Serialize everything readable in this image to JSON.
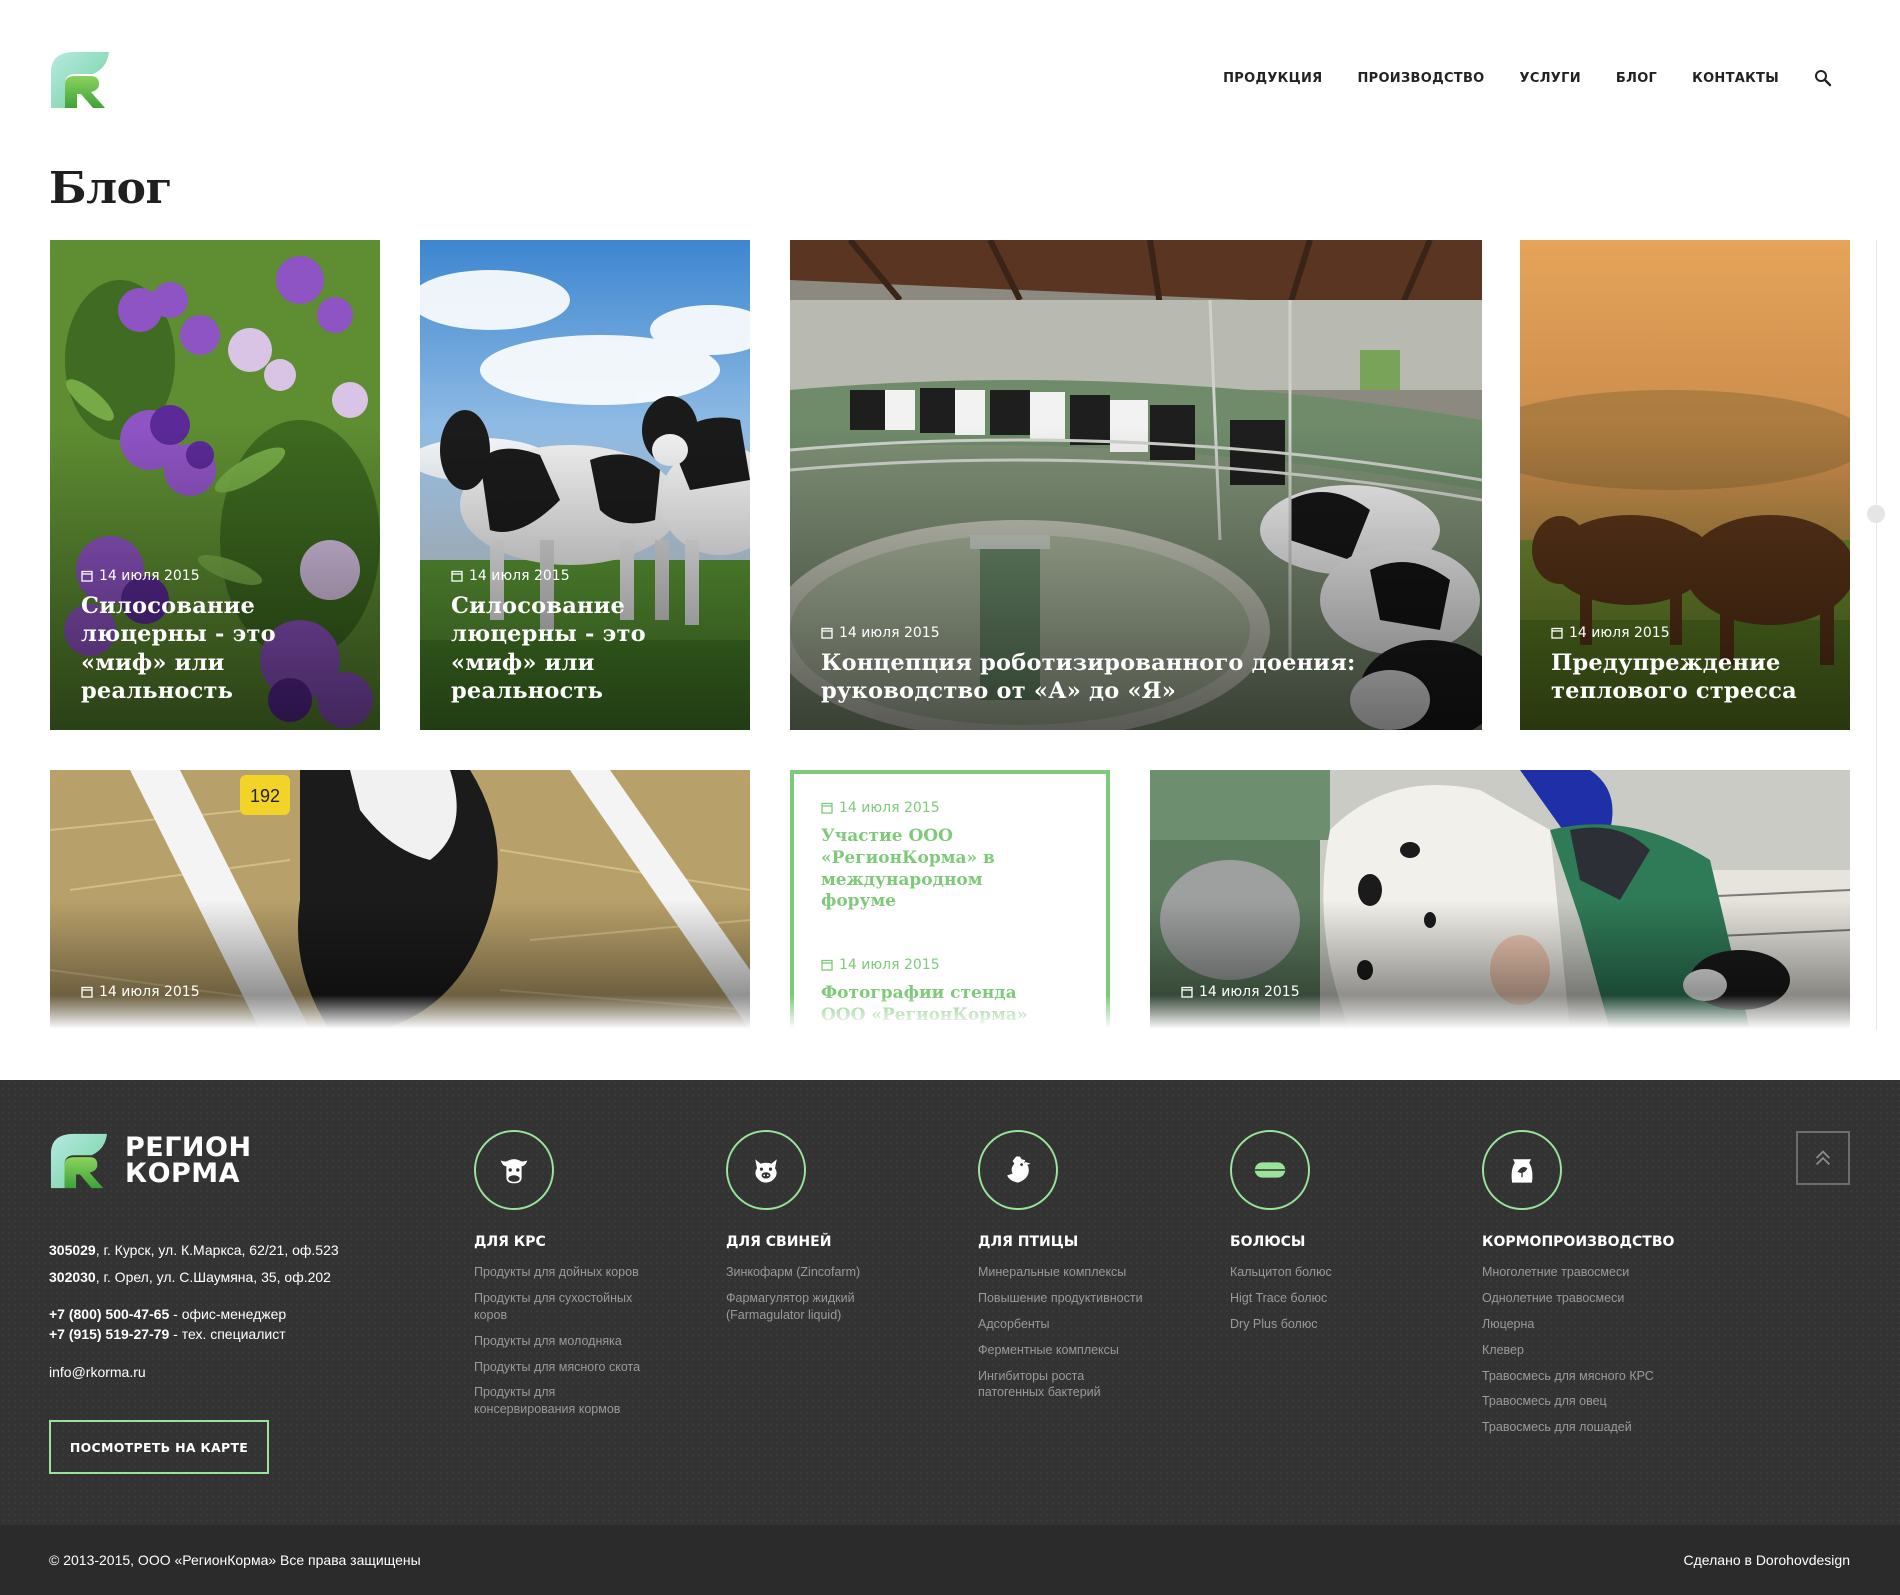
{
  "header": {
    "nav": [
      "ПРОДУКЦИЯ",
      "ПРОИЗВОДСТВО",
      "УСЛУГИ",
      "БЛОГ",
      "КОНТАКТЫ"
    ]
  },
  "page": {
    "title": "Блог"
  },
  "posts": [
    {
      "date": "14 июля 2015",
      "title": "Силосование люцерны - это «миф» или реальность",
      "image": "alfalfa-flowers"
    },
    {
      "date": "14 июля 2015",
      "title": "Силосование люцерны - это «миф» или реальность",
      "image": "cows-on-grass"
    },
    {
      "date": "14 июля 2015",
      "title": "Концепция роботизированного доения: руководство от «А» до «Я»",
      "image": "rotary-milking-parlor"
    },
    {
      "date": "14 июля 2015",
      "title": "Предупреждение теплового стресса",
      "image": "cows-at-sunset"
    },
    {
      "date": "14 июля 2015",
      "title": "",
      "image": "calf-eating-hay"
    },
    {
      "date": "14 июля 2015",
      "title": "",
      "image": "farmer-milking-cow"
    }
  ],
  "text_card": [
    {
      "date": "14 июля 2015",
      "title": "Участие ООО «РегионКорма» в международном форуме"
    },
    {
      "date": "14 июля 2015",
      "title": "Фотографии стенда ООО «РегионКорма»"
    }
  ],
  "footer": {
    "brand_line1": "РЕГИОН",
    "brand_line2": "КОРМА",
    "address1_index": "305029",
    "address1_text": ", г. Курск, ул. К.Маркса, 62/21, оф.523",
    "address2_index": "302030",
    "address2_text": ", г. Орел, ул. С.Шаумяна, 35, оф.202",
    "phone1": "+7 (800) 500-47-65",
    "phone1_note": " - офис-менеджер",
    "phone2": "+7 (915) 519-27-79",
    "phone2_note": " - тех. специалист",
    "email": "info@rkorma.ru",
    "map_button": "ПОСМОТРЕТЬ НА КАРТЕ",
    "columns": [
      {
        "icon": "cow-icon",
        "title": "ДЛЯ КРС",
        "links": [
          "Продукты для дойных коров",
          "Продукты для сухостойных коров",
          "Продукты для молодняка",
          "Продукты для мясного скота",
          "Продукты для консервирования кормов"
        ]
      },
      {
        "icon": "pig-icon",
        "title": "ДЛЯ СВИНЕЙ",
        "links": [
          "Зинкофарм (Zincofarm)",
          "Фармагулятор жидкий (Farmagulator liquid)"
        ]
      },
      {
        "icon": "chicken-icon",
        "title": "ДЛЯ ПТИЦЫ",
        "links": [
          "Минеральные комплексы",
          "Повышение продуктивности",
          "Адсорбенты",
          "Ферментные комплексы",
          "Ингибиторы роста патогенных бактерий"
        ]
      },
      {
        "icon": "bolus-icon",
        "title": "БОЛЮСЫ",
        "links": [
          "Кальцитоп болюс",
          "Higt Trace болюс",
          "Dry Plus болюс"
        ]
      },
      {
        "icon": "feed-bag-icon",
        "title": "КОРМОПРОИЗВОДСТВО",
        "links": [
          "Многолетние травосмеси",
          "Однолетние травосмеси",
          "Люцерна",
          "Клевер",
          "Травосмесь для мясного КРС",
          "Травосмесь для овец",
          "Травосмесь для лошадей"
        ]
      }
    ],
    "copyright": "© 2013-2015, ООО «РегионКорма»  Все права защищены",
    "made_by": "Сделано в Dorohovdesign"
  },
  "colors": {
    "accent": "#7fc97a",
    "footer_bg": "#333333",
    "bottom_bar": "#2b2b2b"
  }
}
